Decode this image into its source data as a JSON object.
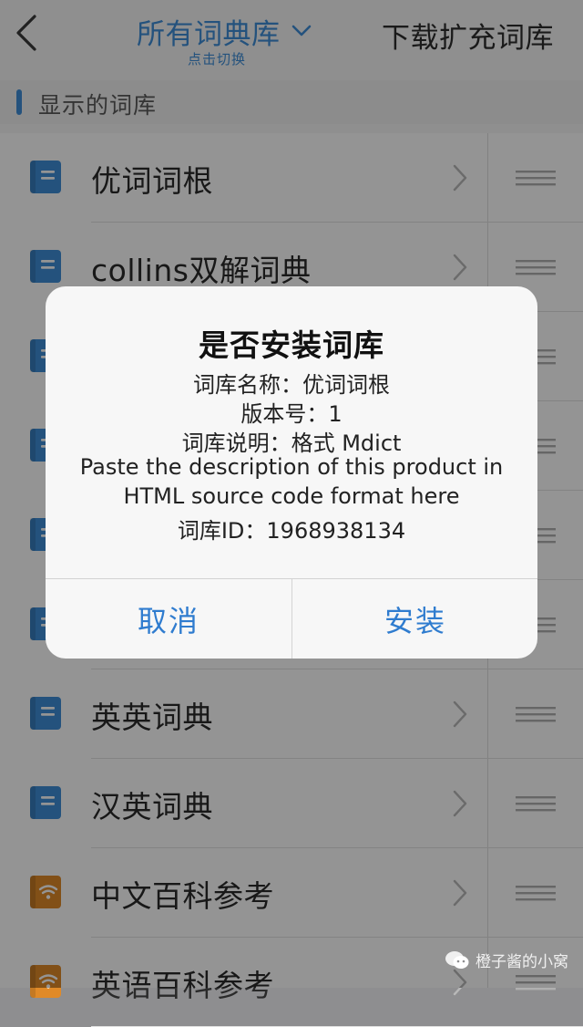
{
  "header": {
    "title": "所有词典库",
    "subtitle": "点击切换",
    "download_label": "下载扩充词库"
  },
  "section": {
    "title": "显示的词库"
  },
  "list": {
    "items": [
      {
        "label": "优词词根",
        "icon": "book-icon",
        "color": "#3e8ed8"
      },
      {
        "label": "collins双解词典",
        "icon": "book-icon",
        "color": "#3e8ed8"
      },
      {
        "label": "",
        "icon": "book-icon",
        "color": "#3e8ed8"
      },
      {
        "label": "",
        "icon": "book-icon",
        "color": "#3e8ed8"
      },
      {
        "label": "",
        "icon": "book-icon",
        "color": "#3e8ed8"
      },
      {
        "label": "",
        "icon": "book-icon",
        "color": "#3e8ed8"
      },
      {
        "label": "英英词典",
        "icon": "book-icon",
        "color": "#3e8ed8"
      },
      {
        "label": "汉英词典",
        "icon": "book-icon",
        "color": "#3e8ed8"
      },
      {
        "label": "中文百科参考",
        "icon": "wifi-book-icon",
        "color": "#e08a28"
      },
      {
        "label": "英语百科参考",
        "icon": "wifi-book-icon",
        "color": "#e08a28"
      }
    ]
  },
  "dialog": {
    "title": "是否安装词库",
    "lines": [
      "词库名称：优词词根",
      "版本号：1",
      "词库说明：格式 Mdict",
      "Paste the description of this product in",
      "HTML source code format here",
      "词库ID：1968938134"
    ],
    "cancel_label": "取消",
    "install_label": "安装"
  },
  "watermark": {
    "text": "橙子酱的小窝"
  },
  "colors": {
    "accent": "#3e8ed8",
    "orange": "#e08a28",
    "dialog_button": "#2f7ccf"
  }
}
